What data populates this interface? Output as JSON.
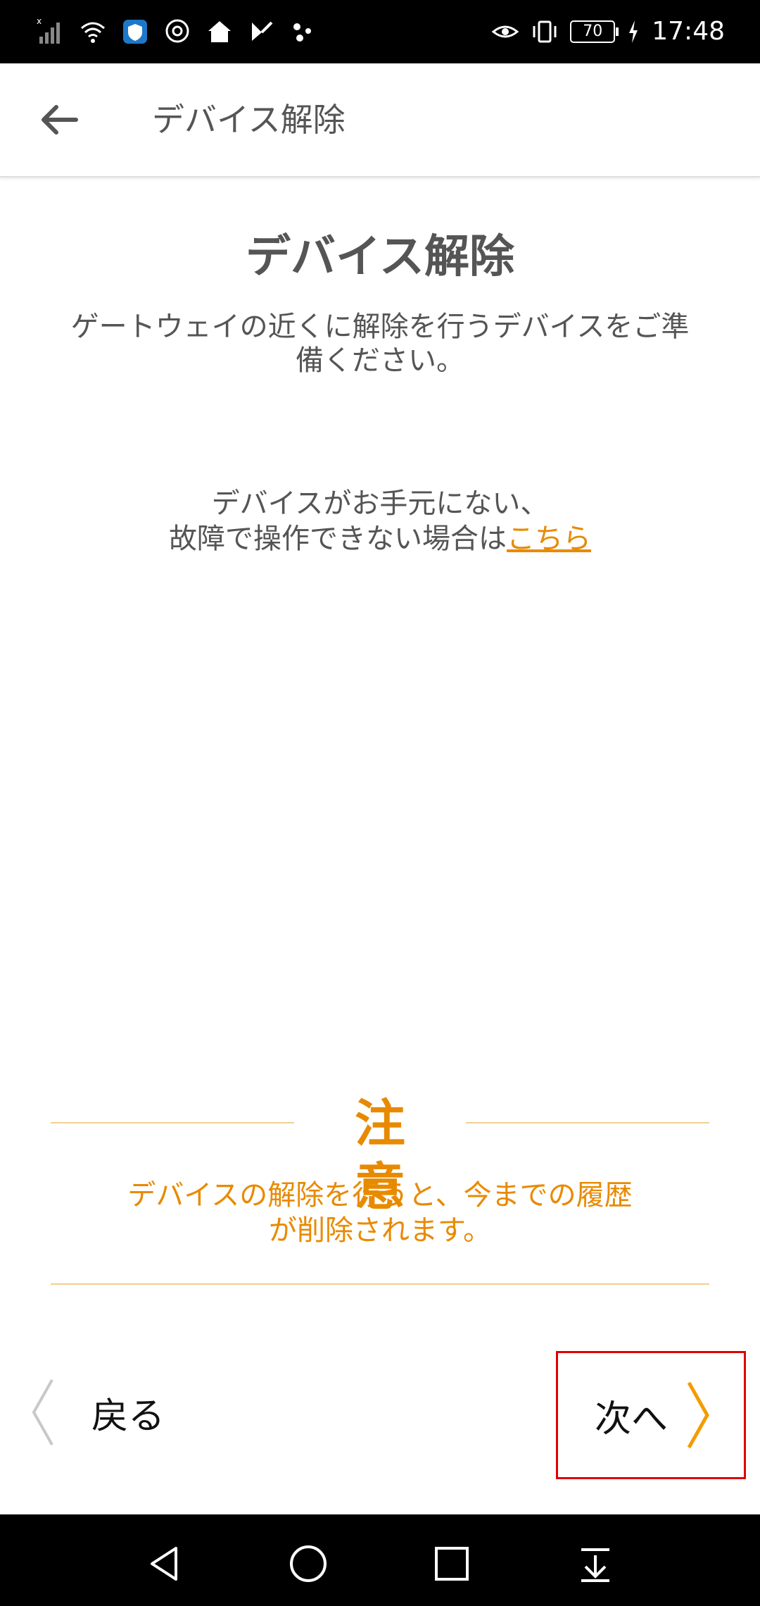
{
  "status_bar": {
    "time": "17:48",
    "battery_level": "70",
    "left_icons": [
      "signal-icon",
      "wifi-icon",
      "shield-app-icon",
      "chrome-icon",
      "home-icon",
      "media-icon",
      "dots-icon"
    ],
    "right_icons": [
      "eye-icon",
      "vibrate-icon",
      "battery-icon",
      "charging-icon"
    ]
  },
  "header": {
    "title": "デバイス解除",
    "back_icon": "back-arrow-icon"
  },
  "main": {
    "title": "デバイス解除",
    "instruction_line1": "ゲートウェイの近くに解除を行うデバイスをご準",
    "instruction_line2": "備ください。",
    "no_device_line1": "デバイスがお手元にない、",
    "no_device_line2_prefix": "故障で操作できない場合は",
    "no_device_link": "こちら"
  },
  "caution": {
    "heading": "注意",
    "text_line1": "デバイスの解除を行うと、今までの履歴",
    "text_line2": "が削除されます。"
  },
  "nav": {
    "back_label": "戻る",
    "next_label": "次へ"
  },
  "system_nav": {
    "icons": [
      "back-triangle-icon",
      "home-circle-icon",
      "recents-square-icon",
      "notification-pulldown-icon"
    ]
  },
  "colors": {
    "accent": "#e88a00",
    "caution_line": "#f3cf90",
    "highlight_box": "#e00000",
    "text_gray": "#555555"
  }
}
